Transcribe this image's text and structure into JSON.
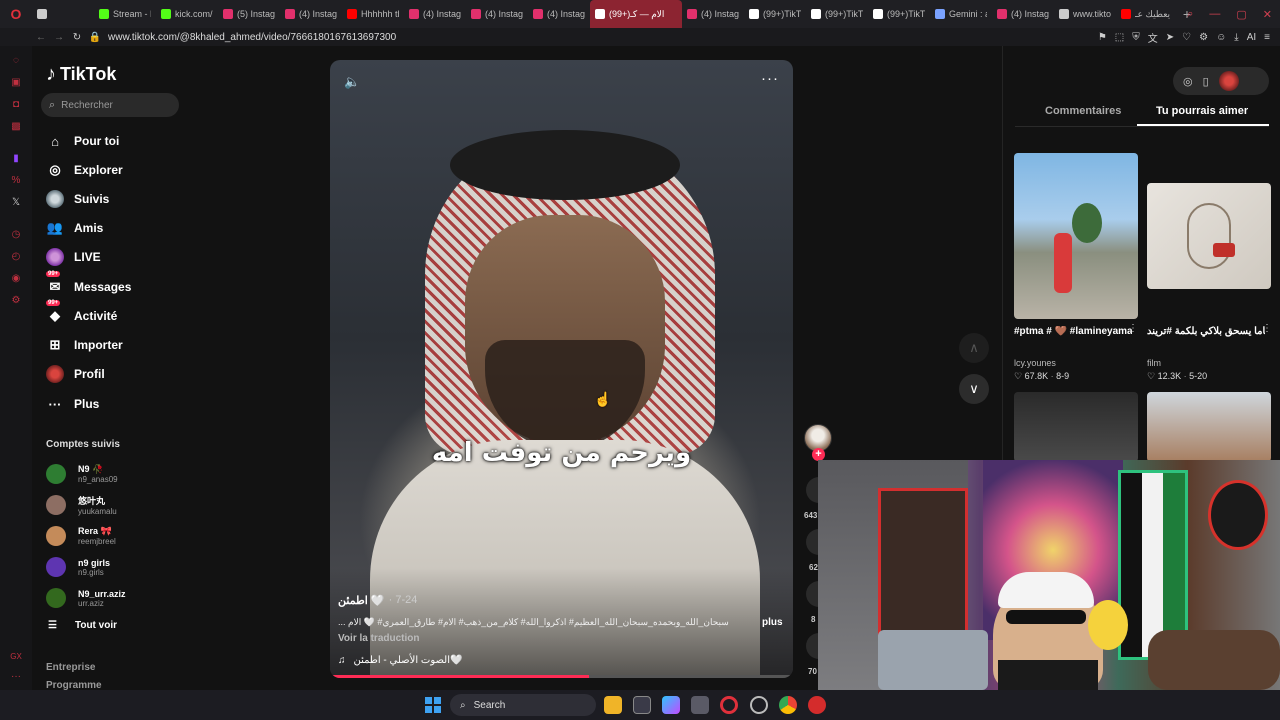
{
  "browser": {
    "tabs": [
      {
        "label": "",
        "color": "#cccccc"
      },
      {
        "label": "Stream - K",
        "color": "#53fc18"
      },
      {
        "label": "kick.com/",
        "color": "#53fc18"
      },
      {
        "label": "(5) Instagr",
        "color": "#e1306c"
      },
      {
        "label": "(4) Instagr",
        "color": "#e1306c"
      },
      {
        "label": "Hhhhhh th",
        "color": "#ff0000"
      },
      {
        "label": "(4) Instagr",
        "color": "#e1306c"
      },
      {
        "label": "(4) Instagr",
        "color": "#e1306c"
      },
      {
        "label": "(4) Instagr",
        "color": "#e1306c"
      },
      {
        "label": "(99+)الام — كـ",
        "color": "#ffffff",
        "active": true
      },
      {
        "label": "(4) Instagr",
        "color": "#e1306c"
      },
      {
        "label": "(99+)TikT",
        "color": "#ffffff"
      },
      {
        "label": "(99+)TikT",
        "color": "#ffffff"
      },
      {
        "label": "(99+)TikT",
        "color": "#ffffff"
      },
      {
        "label": "Gemini : a",
        "color": "#7aa2ff"
      },
      {
        "label": "(4) Instagr",
        "color": "#e1306c"
      },
      {
        "label": "www.tikto",
        "color": "#cccccc"
      },
      {
        "label": "يعطيك عـ",
        "color": "#ff0000"
      }
    ],
    "new_tab": "+",
    "url": "www.tiktok.com/@8khaled_ahmed/video/7666180167613697300",
    "ai_label": "AI"
  },
  "nav": {
    "logo": "TikTok",
    "search_placeholder": "Rechercher",
    "items": [
      {
        "label": "Pour toi",
        "icon": "⌂"
      },
      {
        "label": "Explorer",
        "icon": "◎"
      },
      {
        "label": "Suivis",
        "icon": "●"
      },
      {
        "label": "Amis",
        "icon": "👥"
      },
      {
        "label": "LIVE",
        "icon": "●"
      },
      {
        "label": "Messages",
        "icon": "✉",
        "badge": "99+"
      },
      {
        "label": "Activité",
        "icon": "◆",
        "badge": "99+"
      },
      {
        "label": "Importer",
        "icon": "⊞"
      },
      {
        "label": "Profil",
        "icon": "●"
      },
      {
        "label": "Plus",
        "icon": "···"
      }
    ],
    "followed_title": "Comptes suivis",
    "followed": [
      {
        "name": "N9 🥀",
        "handle": "n9_anas09",
        "color": "#2e7d32"
      },
      {
        "name": "悠叶丸",
        "handle": "yuukamalu",
        "color": "#8d6e63"
      },
      {
        "name": "Rera 🎀",
        "handle": "reemjbreel",
        "color": "#c48b5a"
      },
      {
        "name": "n9 girls",
        "handle": "n9.girls",
        "color": "#5e35b1"
      },
      {
        "name": "N9_urr.aziz",
        "handle": "urr.aziz",
        "color": "#33691e"
      }
    ],
    "see_all": "Tout voir",
    "see_all_icon": "☰",
    "footer": [
      "Entreprise",
      "Programme"
    ]
  },
  "video": {
    "subtitle": "ويرحم من توفت امه",
    "author": "اطمئن 🤍",
    "date": "· 7-24",
    "caption": "سبحان_الله_وبحمده_سبحان_الله_العظيم# اذكروا_الله# كلام_من_ذهب# الام# طارق_العمري# 🤍 الام ...",
    "more": "plus",
    "translate": "Voir la traduction",
    "music_icon": "♫",
    "music": "الصوت الأصلي - اطمئن🤍",
    "progress": 0.56,
    "mute_icon": "🔈",
    "more_icon": "···"
  },
  "actions": {
    "follow_icon": "+",
    "likes": "643",
    "comments": "62",
    "saves": "8",
    "shares": "70"
  },
  "scroll": {
    "up": "∧",
    "down": "∨"
  },
  "panel": {
    "tab_comments": "Commentaires",
    "tab_you_may_like": "Tu pourrais aimer",
    "recommendations": [
      {
        "title": "#ptma # 🤎 #lamineyamal #dance...",
        "author": "lcy.younes",
        "likes": "67.8K",
        "date": "8-9"
      },
      {
        "title": "سايتاما يسحق بلاكي بلكمة #تريند #foryou #kdrama...",
        "author": "film",
        "likes": "12.3K",
        "date": "5-20"
      }
    ],
    "more_icon": "⋮",
    "heart_icon": "♡"
  },
  "taskbar": {
    "search_label": "Search"
  }
}
